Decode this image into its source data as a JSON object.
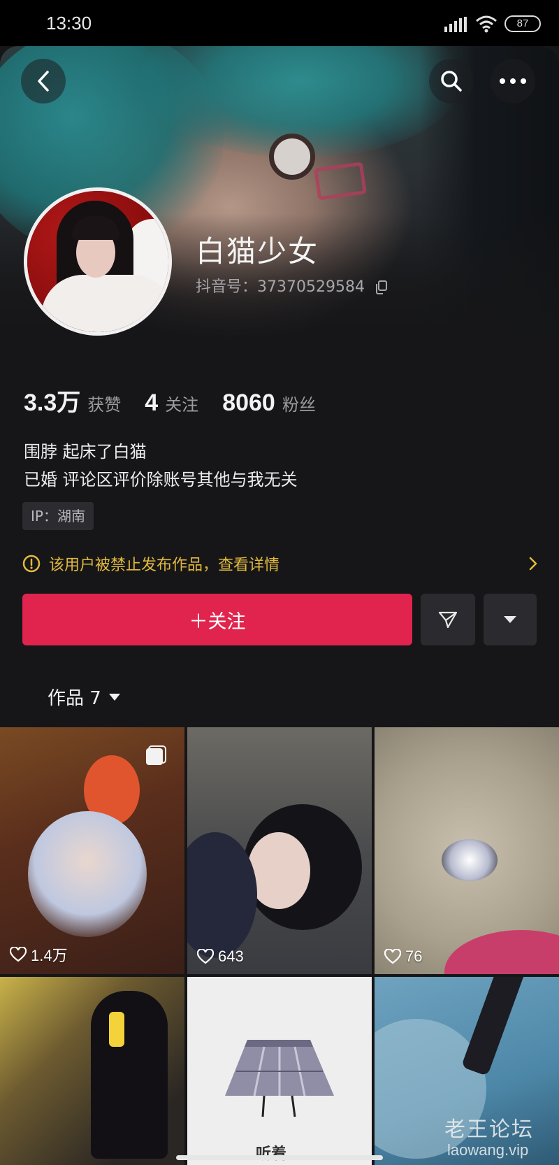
{
  "status_bar": {
    "time": "13:30",
    "battery": "87",
    "icons": [
      "signal-icon",
      "wifi-icon",
      "battery-icon"
    ]
  },
  "header": {
    "back_icon": "chevron-left-icon",
    "search_icon": "search-icon",
    "more_icon": "more-dots-icon"
  },
  "profile": {
    "name": "白猫少女",
    "douyin_id": "抖音号：37370529584"
  },
  "stats": [
    {
      "value": "3.3万",
      "label": "获赞"
    },
    {
      "value": "4",
      "label": "关注"
    },
    {
      "value": "8060",
      "label": "粉丝"
    }
  ],
  "bio": {
    "line1": "围脖 起床了白猫",
    "line2": "已婚 评论区评价除账号其他与我无关"
  },
  "ip_location": "IP：湖南",
  "notice": {
    "text": "该用户被禁止发布作品，查看详情",
    "icon": "warning-icon"
  },
  "actions": {
    "follow_label": "＋关注",
    "share_icon": "send-icon",
    "more_icon": "triangle-down-icon"
  },
  "works_tab": {
    "label": "作品 7"
  },
  "works": [
    {
      "likes": "1.4万",
      "pinned": true
    },
    {
      "likes": "643",
      "pinned": false
    },
    {
      "likes": "76",
      "pinned": false
    },
    {
      "likes": "",
      "pinned": false
    },
    {
      "likes": "",
      "pinned": false,
      "caption": "听着"
    },
    {
      "likes": "",
      "pinned": false
    }
  ],
  "watermark": {
    "cn": "老王论坛",
    "en": "laowang.vip"
  },
  "colors": {
    "accent": "#e1244d",
    "warning": "#e2b93f",
    "background": "#161618"
  }
}
